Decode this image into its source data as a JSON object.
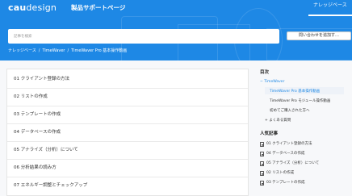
{
  "header": {
    "logo_bold": "cau",
    "logo_rest": "design",
    "site_title": "製品サポートページ",
    "nav_link": "ナレッジベース"
  },
  "search": {
    "placeholder": "記事を検索"
  },
  "contact_button": "問い合わせを追加す…",
  "breadcrumb": [
    "ナレッジベース",
    "TimeWaver",
    "TimeWaver Pro 基本操作動画"
  ],
  "articles": [
    "01 クライアント登録の方法",
    "02 リストの作成",
    "03 テンプレートの作成",
    "04 データベースの作成",
    "05 アナライズ（分析）について",
    "06 分析結果の読み方",
    "07 エネルギー調整とチェックアップ"
  ],
  "sidebar": {
    "toc_heading": "目次",
    "toc": {
      "parent": "− TimeWaver",
      "children": [
        "TimeWaver Pro 基本操作動画",
        "TimeWaver Pro モジュール操作動画",
        "初めてご購入された方へ"
      ],
      "faq": "+ よくある質問"
    },
    "popular_heading": "人気記事",
    "popular": [
      "01 クライアント登録の方法",
      "04 データベースの作成",
      "05 アナライズ（分析）について",
      "02 リストの作成",
      "03 テンプレートの作成"
    ]
  },
  "colors": {
    "header_blue": "#1e88e5",
    "link_blue": "#1e88e5",
    "content_bg": "#f7f8fa"
  }
}
